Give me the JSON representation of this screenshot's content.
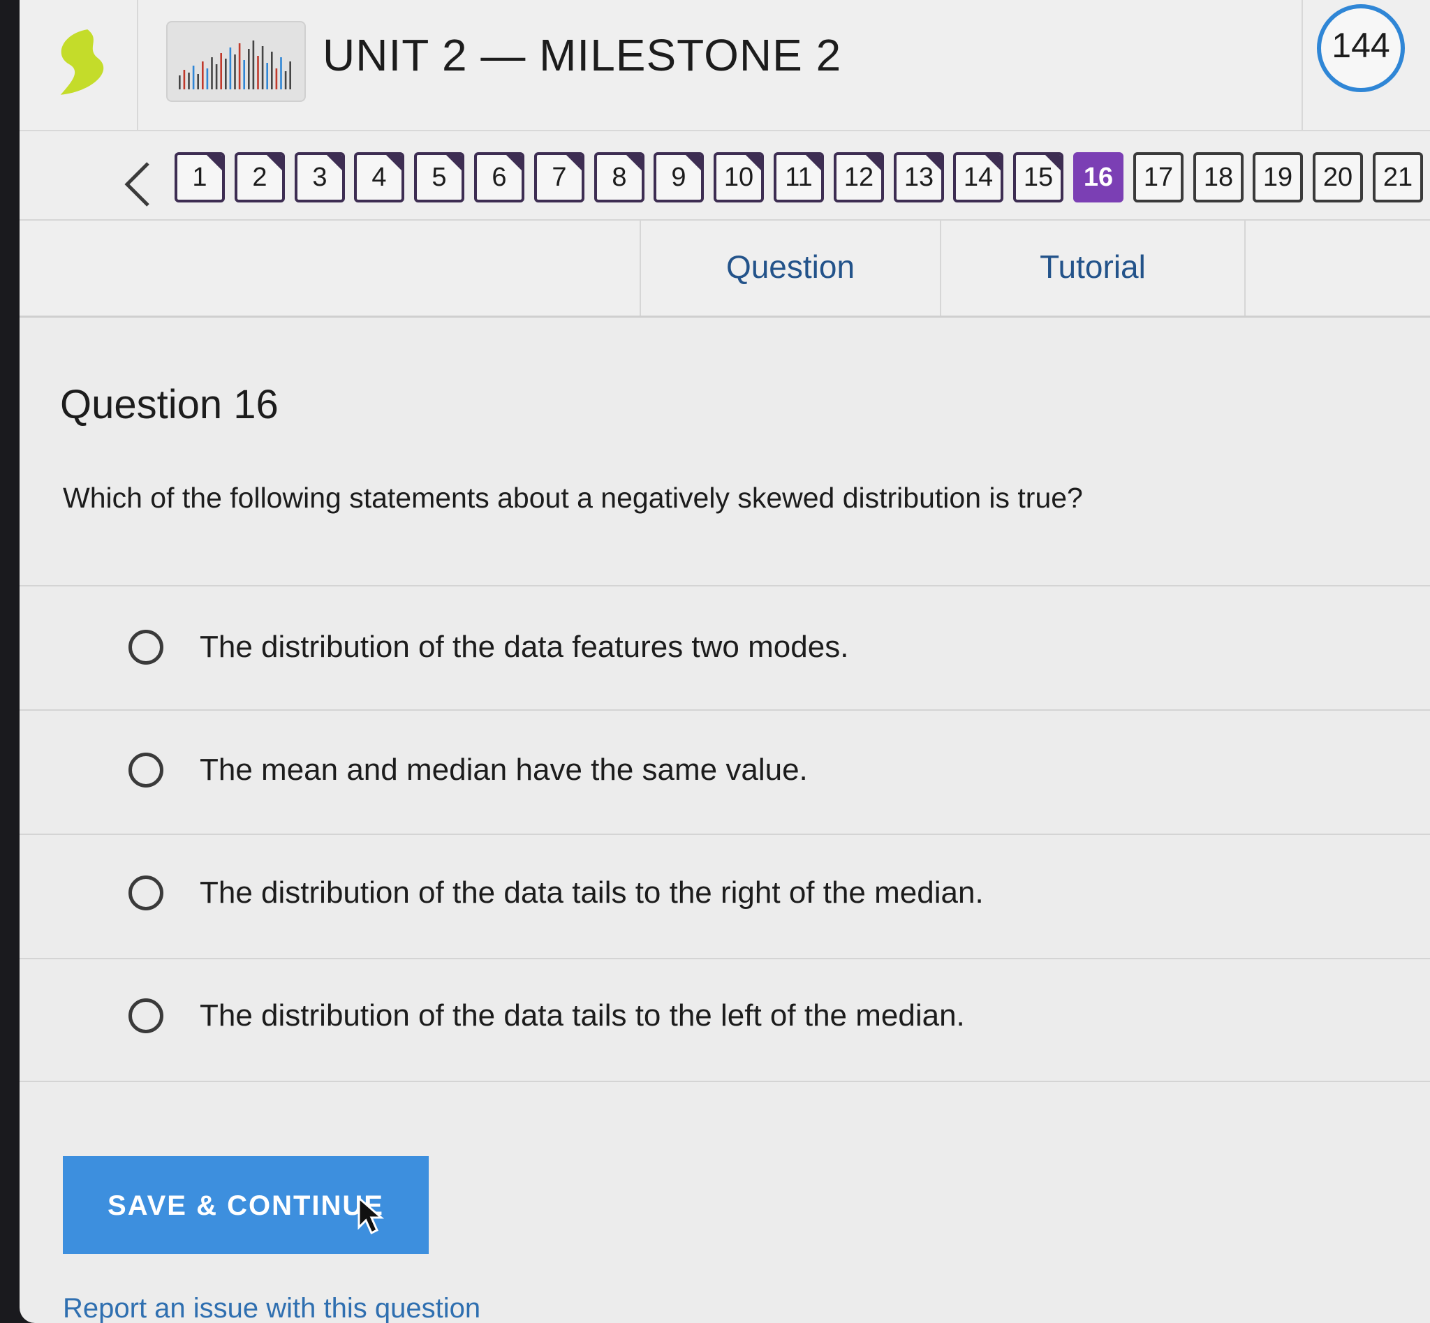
{
  "header": {
    "title": "UNIT 2 — MILESTONE 2",
    "timer": "144",
    "logo_icon": "sophia-leaf-icon",
    "thumbnail_icon": "bar-pattern-thumbnail"
  },
  "nav": {
    "back_icon": "chevron-left-icon",
    "questions": [
      {
        "label": "1",
        "state": "answered"
      },
      {
        "label": "2",
        "state": "answered"
      },
      {
        "label": "3",
        "state": "answered"
      },
      {
        "label": "4",
        "state": "answered"
      },
      {
        "label": "5",
        "state": "answered"
      },
      {
        "label": "6",
        "state": "answered"
      },
      {
        "label": "7",
        "state": "answered"
      },
      {
        "label": "8",
        "state": "answered"
      },
      {
        "label": "9",
        "state": "answered"
      },
      {
        "label": "10",
        "state": "answered"
      },
      {
        "label": "11",
        "state": "answered"
      },
      {
        "label": "12",
        "state": "answered"
      },
      {
        "label": "13",
        "state": "answered"
      },
      {
        "label": "14",
        "state": "answered"
      },
      {
        "label": "15",
        "state": "answered"
      },
      {
        "label": "16",
        "state": "current"
      },
      {
        "label": "17",
        "state": "unanswered"
      },
      {
        "label": "18",
        "state": "unanswered"
      },
      {
        "label": "19",
        "state": "unanswered"
      },
      {
        "label": "20",
        "state": "unanswered"
      },
      {
        "label": "21",
        "state": "unanswered"
      }
    ]
  },
  "tabs": {
    "question": "Question",
    "tutorial": "Tutorial"
  },
  "question": {
    "title": "Question 16",
    "prompt": "Which of the following statements about a negatively skewed distribution is true?",
    "options": [
      "The distribution of the data features two modes.",
      "The mean and median have the same value.",
      "The distribution of the data tails to the right of the median.",
      "The distribution of the data tails to the left of the median."
    ]
  },
  "actions": {
    "save_label": "SAVE & CONTINUE",
    "report_label": "Report an issue with this question"
  },
  "colors": {
    "accent_blue": "#3d8fde",
    "current_purple": "#7b3fb4",
    "answered_border": "#3d2d52",
    "link_blue": "#2f6fb0",
    "logo_green": "#c4dc2a"
  }
}
